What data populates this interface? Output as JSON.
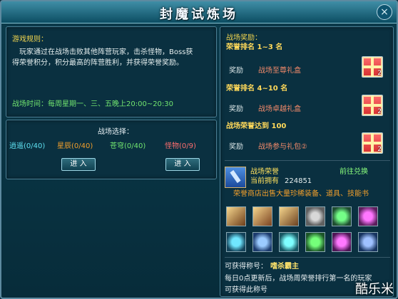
{
  "window": {
    "title": "封魔试炼场",
    "close_icon": "close-icon"
  },
  "rules": {
    "heading": "游戏规则：",
    "line1": "玩家通过在战场击败其他阵营玩家，击杀怪物，Boss获",
    "line2": "得荣誉积分，积分最高的阵营胜利，并获得荣誉奖励。",
    "time": "战场时间：每周星期一、三、五晚上20:00~20:30"
  },
  "battle_select": {
    "heading": "战场选择：",
    "factions": [
      {
        "name": "逍遥",
        "count": "(0/40)"
      },
      {
        "name": "星辰",
        "count": "(0/40)"
      },
      {
        "name": "苍穹",
        "count": "(0/40)"
      },
      {
        "name": "怪物",
        "count": "(0/9)"
      }
    ],
    "enter_label": "进  入"
  },
  "rewards": {
    "heading": "战场奖励：",
    "rows": [
      {
        "title": "荣誉排名 1~3 名",
        "key": "奖励",
        "value": "战场至尊礼盒",
        "count": "2"
      },
      {
        "title": "荣誉排名 4~10 名",
        "key": "奖励",
        "value": "战场卓越礼盒",
        "count": "2"
      },
      {
        "title": "战场荣誉达到 100",
        "key": "奖励",
        "value": "战场参与礼包②",
        "count": "2"
      }
    ]
  },
  "honor": {
    "title": "战场荣誉",
    "link": "前往兑换",
    "current_label": "当前拥有",
    "current_value": "224851",
    "shop_note": "荣誉商店出售大量珍稀装备、道具、技能书",
    "shop_icon": "sword-icon"
  },
  "items": [
    "scroll-icon",
    "scroll-icon",
    "scroll-icon",
    "orb-icon",
    "orb-icon",
    "orb-icon",
    "orb-icon",
    "orb-icon",
    "orb-icon",
    "orb-icon",
    "orb-icon",
    "orb-icon"
  ],
  "footer": {
    "title_label": "可获得称号：",
    "title_value": "嗜杀霸主",
    "line2": "每日0点更新后，战场周荣誉排行第一名的玩家",
    "line3": "可获得此称号"
  },
  "watermark": "酷乐米"
}
